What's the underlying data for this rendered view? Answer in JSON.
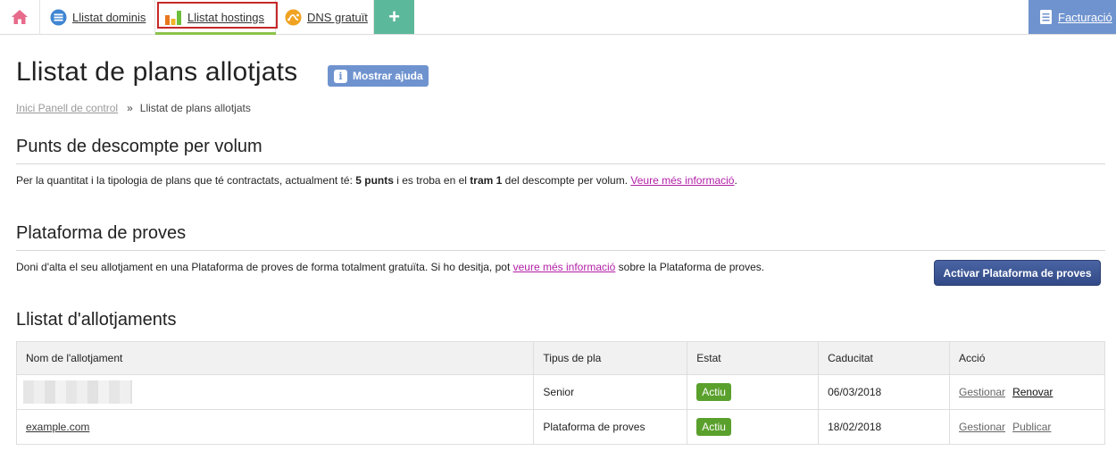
{
  "nav": {
    "tabs": [
      {
        "label": "Llistat dominis",
        "icon": "list-circle-icon"
      },
      {
        "label": "Llistat hostings",
        "icon": "bar-chart-icon"
      },
      {
        "label": "DNS gratuït",
        "icon": "dns-icon"
      }
    ],
    "plus_label": "+",
    "billing_label": "Facturació"
  },
  "colors": {
    "accent_blue": "#6f93cf",
    "plus_green": "#5cb89a",
    "badge_green": "#5aa02c",
    "link_magenta": "#b21fa6",
    "primary_button": "#3d5596",
    "highlight_red": "#c62828"
  },
  "page": {
    "title": "Llistat de plans allotjats",
    "help_button": "Mostrar ajuda",
    "help_icon_glyph": "i"
  },
  "breadcrumb": {
    "home": "Inici Panell de control",
    "separator": "»",
    "current": "Llistat de plans allotjats"
  },
  "discount": {
    "title": "Punts de descompte per volum",
    "text_1": "Per la quantitat i la tipologia de plans que té contractats, actualment té: ",
    "points": "5 punts",
    "text_2": " i es troba en el ",
    "tier": "tram 1",
    "text_3": " del descompte per volum. ",
    "link": "Veure més informació",
    "text_4": "."
  },
  "testing": {
    "title": "Plataforma de proves",
    "text_1": "Doni d'alta el seu allotjament en una Plataforma de proves de forma totalment gratuïta. Si ho desitja, pot ",
    "link": "veure més informació",
    "text_2": " sobre la Plataforma de proves.",
    "button": "Activar Plataforma de proves"
  },
  "hostings": {
    "title": "Llistat d'allotjaments",
    "columns": [
      "Nom de l'allotjament",
      "Tipus de pla",
      "Estat",
      "Caducitat",
      "Acció"
    ],
    "rows": [
      {
        "name": "",
        "plan": "Senior",
        "status": "Actiu",
        "expiry": "06/03/2018",
        "actions": [
          "Gestionar",
          "Renovar"
        ]
      },
      {
        "name": "example.com",
        "plan": "Plataforma de proves",
        "status": "Actiu",
        "expiry": "18/02/2018",
        "actions": [
          "Gestionar",
          "Publicar"
        ]
      }
    ]
  }
}
